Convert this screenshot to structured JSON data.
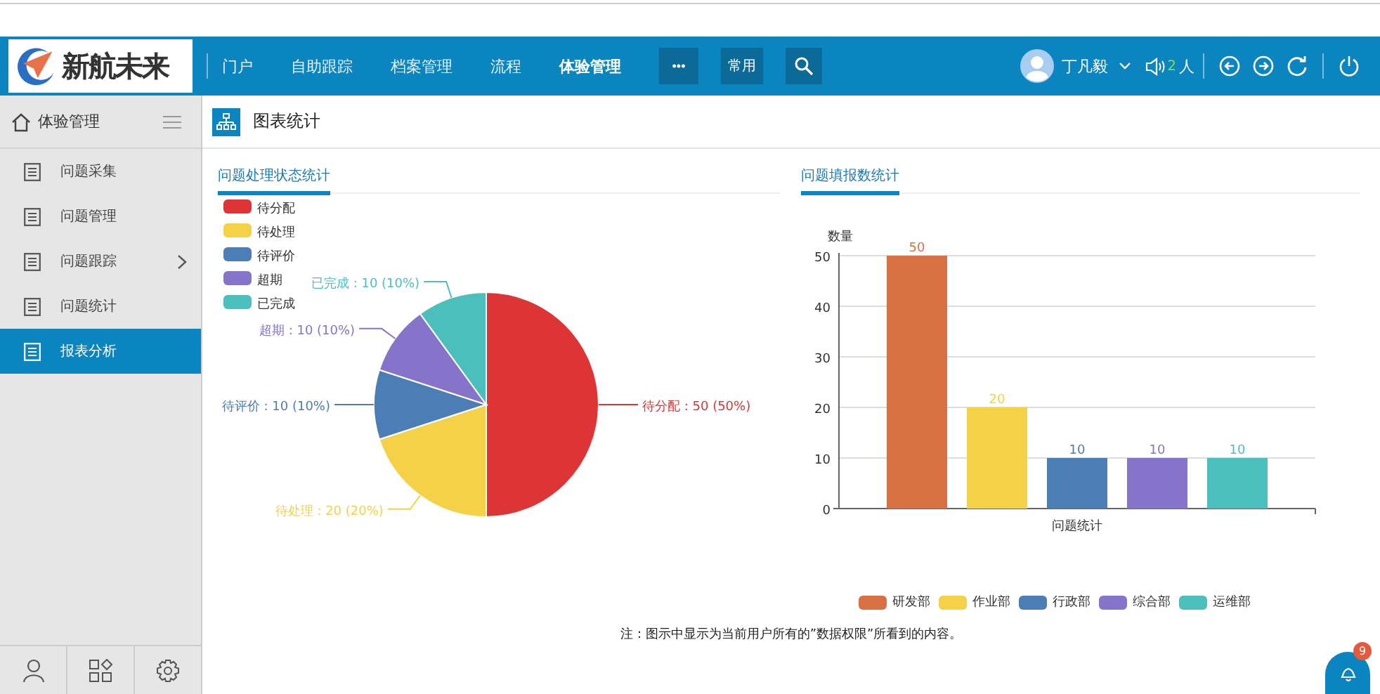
{
  "logo": {
    "text": "新航未来"
  },
  "nav": {
    "items": [
      {
        "label": "门户",
        "selected": false
      },
      {
        "label": "自助跟踪",
        "selected": false
      },
      {
        "label": "档案管理",
        "selected": false
      },
      {
        "label": "流程",
        "selected": false
      },
      {
        "label": "体验管理",
        "selected": true
      }
    ],
    "more_button": "•••",
    "favorites_button": "常用"
  },
  "user": {
    "name": "丁凡毅",
    "online_count": "2",
    "online_unit": "人"
  },
  "sidebar": {
    "title": "体验管理",
    "items": [
      {
        "label": "问题采集",
        "selected": false,
        "has_submenu": false
      },
      {
        "label": "问题管理",
        "selected": false,
        "has_submenu": false
      },
      {
        "label": "问题跟踪",
        "selected": false,
        "has_submenu": true
      },
      {
        "label": "问题统计",
        "selected": false,
        "has_submenu": false
      },
      {
        "label": "报表分析",
        "selected": true,
        "has_submenu": false
      }
    ]
  },
  "page": {
    "title": "图表统计"
  },
  "status_chart": {
    "title": "问题处理状态统计",
    "chart_data": {
      "type": "pie",
      "legend": true,
      "categories": [
        "待分配",
        "待处理",
        "待评价",
        "超期",
        "已完成"
      ],
      "values": [
        50,
        20,
        10,
        10,
        10
      ],
      "colors": [
        "#dd3535",
        "#f5d148",
        "#4a7eb4",
        "#8574c9",
        "#4bbfbc"
      ],
      "value_labels": [
        "待分配 : 50 (50%)",
        "待处理 : 20 (20%)",
        "待评价 : 10 (10%)",
        "超期 : 10 (10%)",
        "已完成 : 10 (10%)"
      ]
    }
  },
  "report_chart": {
    "title": "问题填报数统计",
    "chart_data": {
      "type": "bar",
      "legend": true,
      "grid": true,
      "categories": [
        "问题统计"
      ],
      "ylabel": "数量",
      "ylim": [
        0,
        50
      ],
      "yticks": [
        0,
        10,
        20,
        30,
        40,
        50
      ],
      "data_labels": true,
      "series": [
        {
          "name": "研发部",
          "color": "#d97043",
          "values": [
            50
          ]
        },
        {
          "name": "作业部",
          "color": "#f5d148",
          "values": [
            20
          ]
        },
        {
          "name": "行政部",
          "color": "#4a7eb4",
          "values": [
            10
          ]
        },
        {
          "name": "综合部",
          "color": "#8574c9",
          "values": [
            10
          ]
        },
        {
          "name": "运维部",
          "color": "#4bbfbc",
          "values": [
            10
          ]
        }
      ]
    }
  },
  "note": "注：图示中显示为当前用户所有的”数据权限”所看到的内容。",
  "notification": {
    "count": "9"
  }
}
